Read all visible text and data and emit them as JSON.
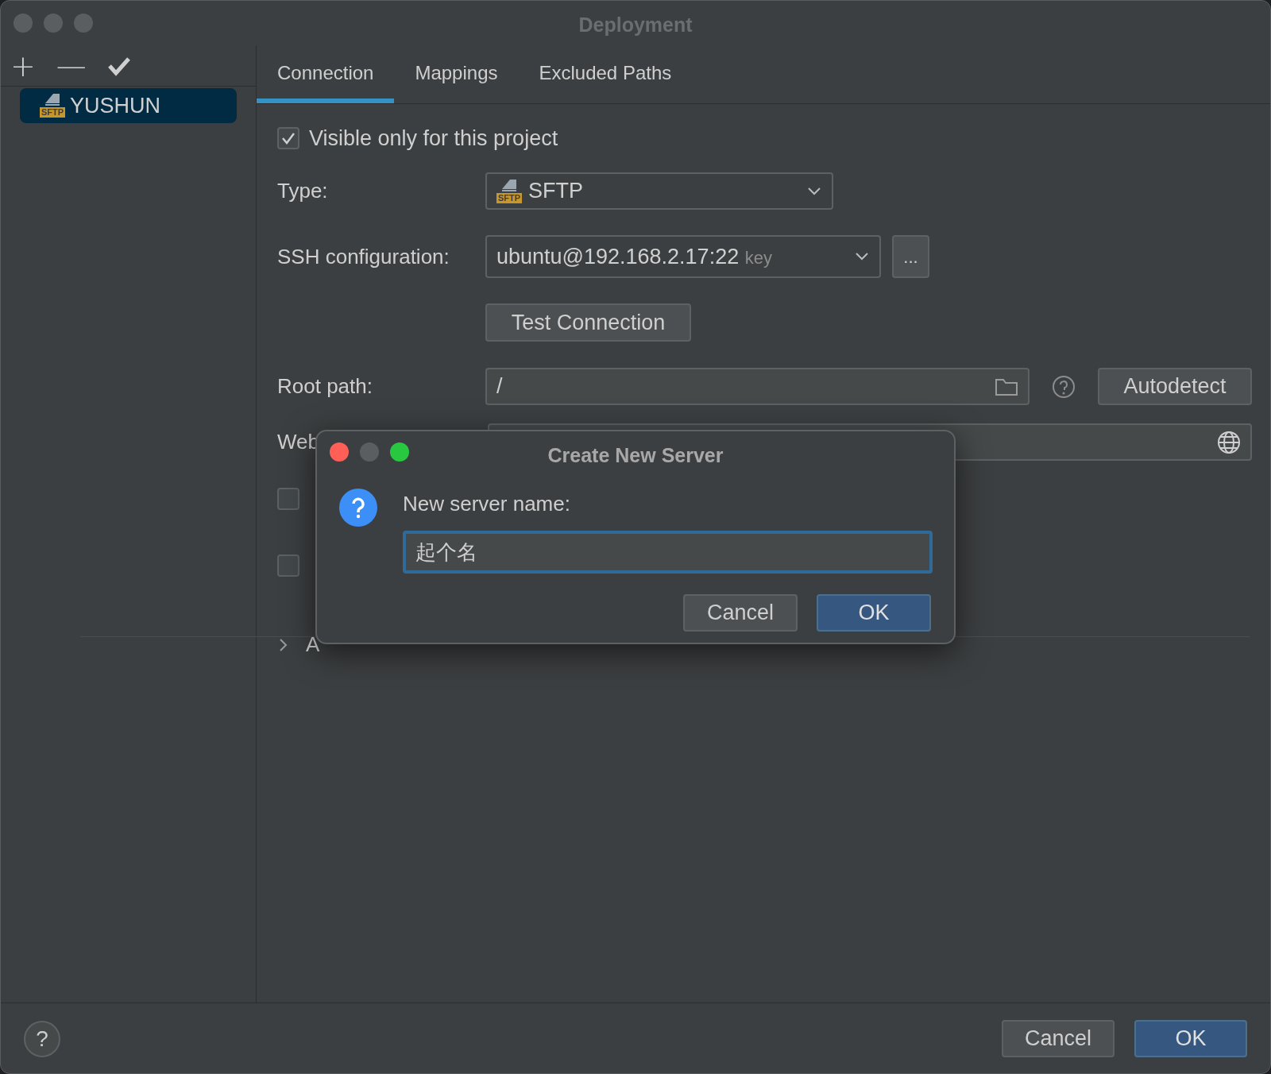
{
  "window": {
    "title": "Deployment",
    "active": false
  },
  "toolbar": [
    "+",
    "—"
  ],
  "servers": [
    {
      "name": "YUSHUN",
      "icon_text": "SFTP",
      "selected": true
    }
  ],
  "tabs": [
    {
      "label": "Connection",
      "selected": true
    },
    {
      "label": "Mappings",
      "selected": false
    },
    {
      "label": "Excluded Paths",
      "selected": false
    }
  ],
  "visible_only": {
    "label": "Visible only for this project",
    "checked": true
  },
  "type": {
    "label": "Type:",
    "value": "SFTP",
    "icon_text": "SFTP"
  },
  "ssh": {
    "label": "SSH configuration:",
    "value": "ubuntu@192.168.2.17:22",
    "hint": "key",
    "more": "..."
  },
  "test_button": "Test Connection",
  "root_path": {
    "label": "Root path:",
    "value": "/",
    "button": "Autodetect"
  },
  "web_url": {
    "label": "Web"
  },
  "options": [
    {
      "checked": false
    },
    {
      "checked": false
    }
  ],
  "advanced": {
    "label": "A",
    "expanded": false
  },
  "footer": {
    "help": "?",
    "buttons": [
      {
        "label": "Cancel",
        "primary": false
      },
      {
        "label": "OK",
        "primary": true
      }
    ]
  },
  "dialog": {
    "title": "Create New Server",
    "active": true,
    "prompt": "New server name:",
    "value": "起个名",
    "buttons": [
      {
        "label": "Cancel",
        "primary": false
      },
      {
        "label": "OK",
        "primary": true
      }
    ]
  }
}
